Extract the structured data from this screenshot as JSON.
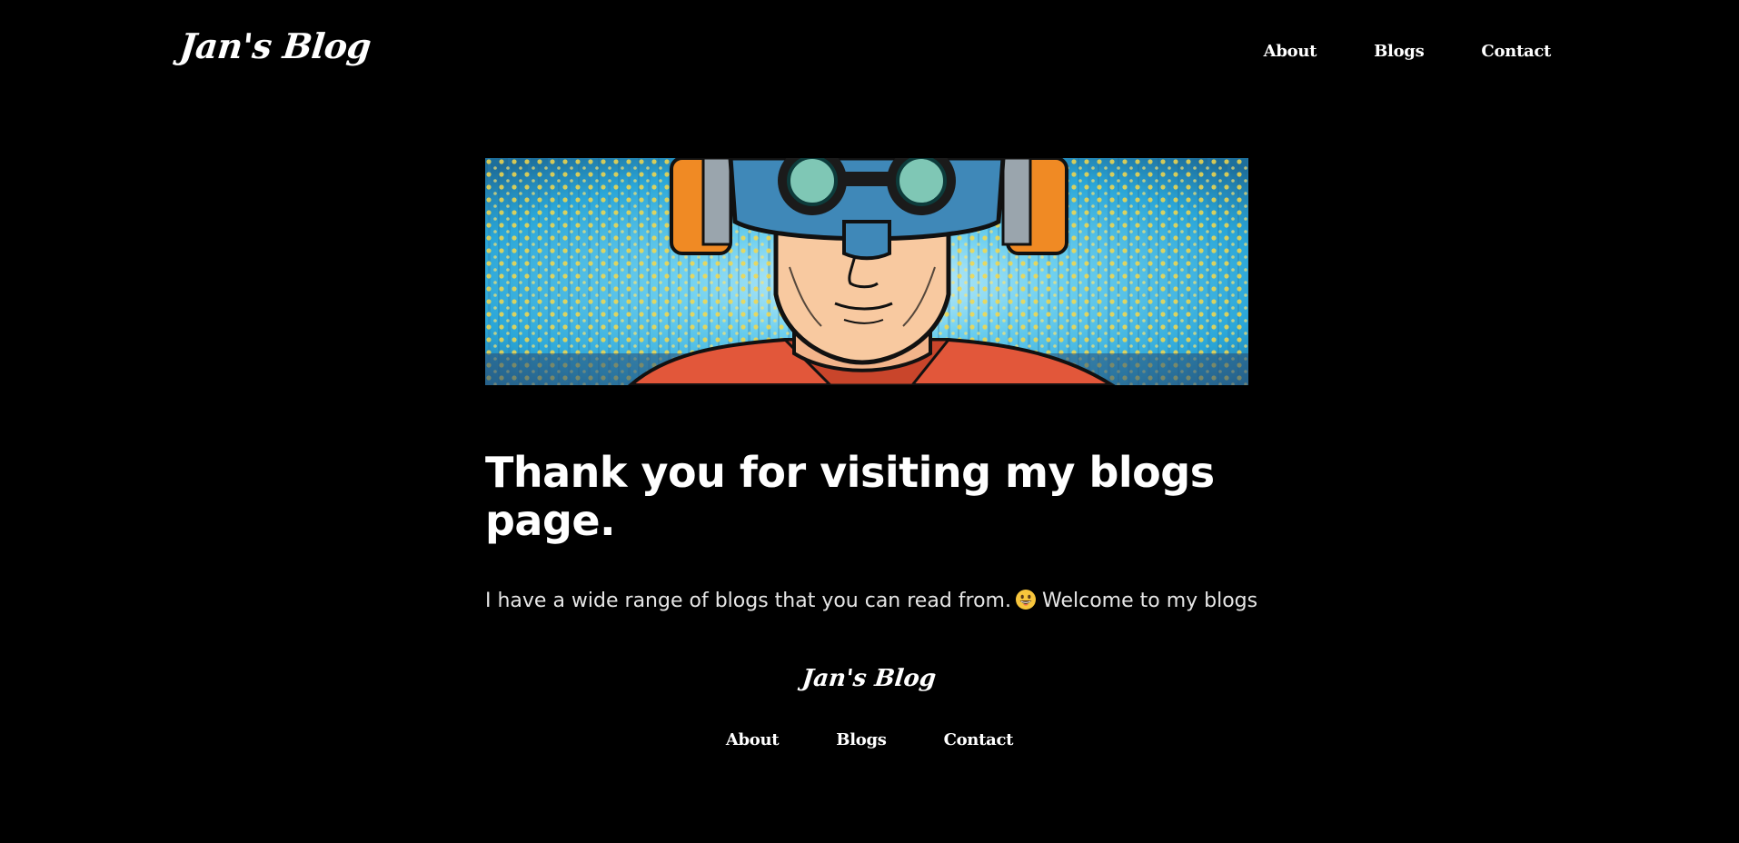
{
  "header": {
    "logo": "Jan's Blog",
    "nav": [
      {
        "label": "About"
      },
      {
        "label": "Blogs"
      },
      {
        "label": "Contact"
      }
    ]
  },
  "hero": {
    "image_icon": "comic-man-with-goggles-and-headphones-illustration"
  },
  "main": {
    "heading": "Thank you for visiting my blogs page.",
    "intro_before_emoji": "I have a wide range of blogs that you can read from.",
    "emoji_icon": "grinning-face-emoji",
    "intro_after_emoji": "Welcome to my blogs"
  },
  "footer": {
    "logo": "Jan's Blog",
    "nav": [
      {
        "label": "About"
      },
      {
        "label": "Blogs"
      },
      {
        "label": "Contact"
      }
    ]
  },
  "colors": {
    "background": "#000000",
    "text": "#ffffff",
    "body_text": "#e6e6e6"
  }
}
